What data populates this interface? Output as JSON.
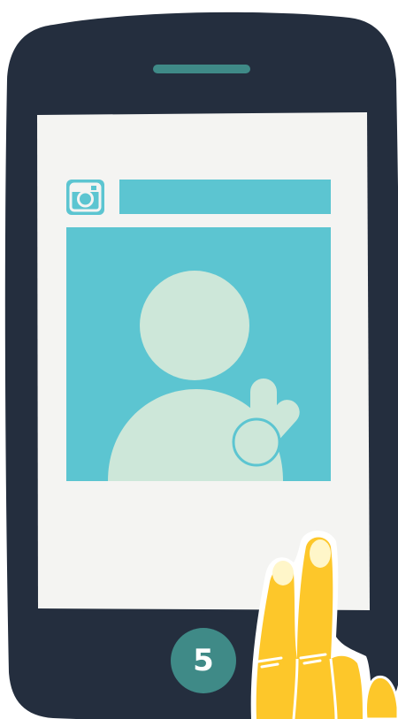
{
  "illustration": {
    "step_number": "5",
    "icons": {
      "phone": "smartphone-icon",
      "app": "instagram-icon",
      "avatar": "user-peace-sign-icon",
      "hand": "tapping-hand-icon"
    },
    "colors": {
      "phone_body": "#242e3e",
      "screen": "#f4f4f2",
      "accent_teal": "#5cc5d1",
      "avatar_fill": "#cde7d9",
      "speaker_bar": "#3f8a87",
      "home_button": "#3f8a87",
      "hand_yellow": "#fdc72a"
    }
  }
}
